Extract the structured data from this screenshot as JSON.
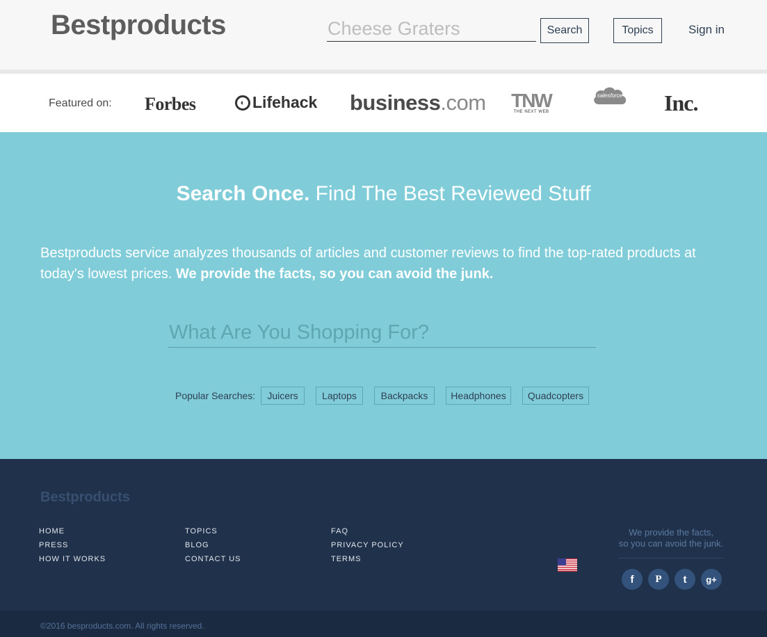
{
  "header": {
    "logo": "Bestproducts",
    "search_placeholder": "Cheese Graters",
    "search_label": "Search",
    "topics_label": "Topics",
    "signin_label": "Sign in"
  },
  "featured": {
    "label": "Featured on:",
    "logos": {
      "forbes": "Forbes",
      "lifehack": "Lifehack",
      "business": "business",
      "business_dom": ".com",
      "tnw": "TNW",
      "tnw_sub": "THE NEXT WEB",
      "salesforce": "salesforce",
      "inc": "Inc."
    }
  },
  "hero": {
    "title_bold": "Search Once.",
    "title_rest": " Find The Best Reviewed Stuff",
    "desc": "Bestproducts service analyzes thousands of articles and customer reviews to find the top-rated products at today's lowest prices. ",
    "desc_bold": "We provide the facts, so you can avoid the junk.",
    "shop_placeholder": "What Are You Shopping For?",
    "popular_label": "Popular Searches:",
    "popular": [
      "Juicers",
      "Laptops",
      "Backpacks",
      "Headphones",
      "Quadcopters"
    ]
  },
  "footer": {
    "logo": "Bestproducts",
    "col1": [
      "HOME",
      "PRESS",
      "HOW IT WORKS"
    ],
    "col2": [
      "TOPICS",
      "BLOG",
      "CONTACT US"
    ],
    "col3": [
      "FAQ",
      "PRIVACY POLICY",
      "TERMS"
    ],
    "tagline_1": "We provide the facts,",
    "tagline_2": "so you can avoid the junk.",
    "copyright": "©2016 besproducts.com. All rights reserved.",
    "social": {
      "facebook": "f",
      "pinterest": "P",
      "twitter": "t",
      "googleplus": "g+"
    }
  },
  "colors": {
    "hero_bg": "#80cdd9",
    "footer_bg": "#20324b",
    "accent_text": "#2e3f52"
  }
}
